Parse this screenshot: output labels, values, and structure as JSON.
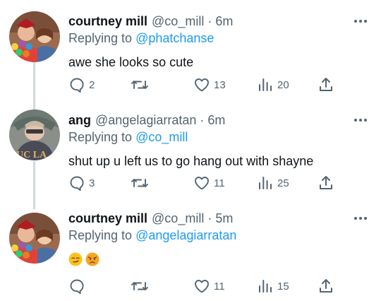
{
  "tweets": [
    {
      "display_name": "courtney mill",
      "handle": "@co_mill",
      "time": "6m",
      "replying_prefix": "Replying to",
      "replying_to": "@phatchanse",
      "text": "awe she looks so cute",
      "emojis": [],
      "replies": "2",
      "retweets": "",
      "likes": "13",
      "views": "20"
    },
    {
      "display_name": "ang",
      "handle": "@angelagiarratan",
      "time": "6m",
      "replying_prefix": "Replying to",
      "replying_to": "@co_mill",
      "text": "shut up u left us to go hang out with shayne",
      "emojis": [],
      "replies": "3",
      "retweets": "",
      "likes": "11",
      "views": "25"
    },
    {
      "display_name": "courtney mill",
      "handle": "@co_mill",
      "time": "5m",
      "replying_prefix": "Replying to",
      "replying_to": "@angelagiarratan",
      "text": "",
      "emojis": [
        "smirking-face",
        "pouting-face"
      ],
      "replies": "",
      "retweets": "",
      "likes": "11",
      "views": "15"
    }
  ],
  "separator": "·",
  "icons": {
    "reply": "reply-icon",
    "retweet": "retweet-icon",
    "like": "heart-icon",
    "views": "views-icon",
    "share": "share-icon",
    "more": "more-icon"
  },
  "colors": {
    "link": "#1d9bf0",
    "secondary_text": "#536471",
    "thread_line": "#cfd9de"
  }
}
